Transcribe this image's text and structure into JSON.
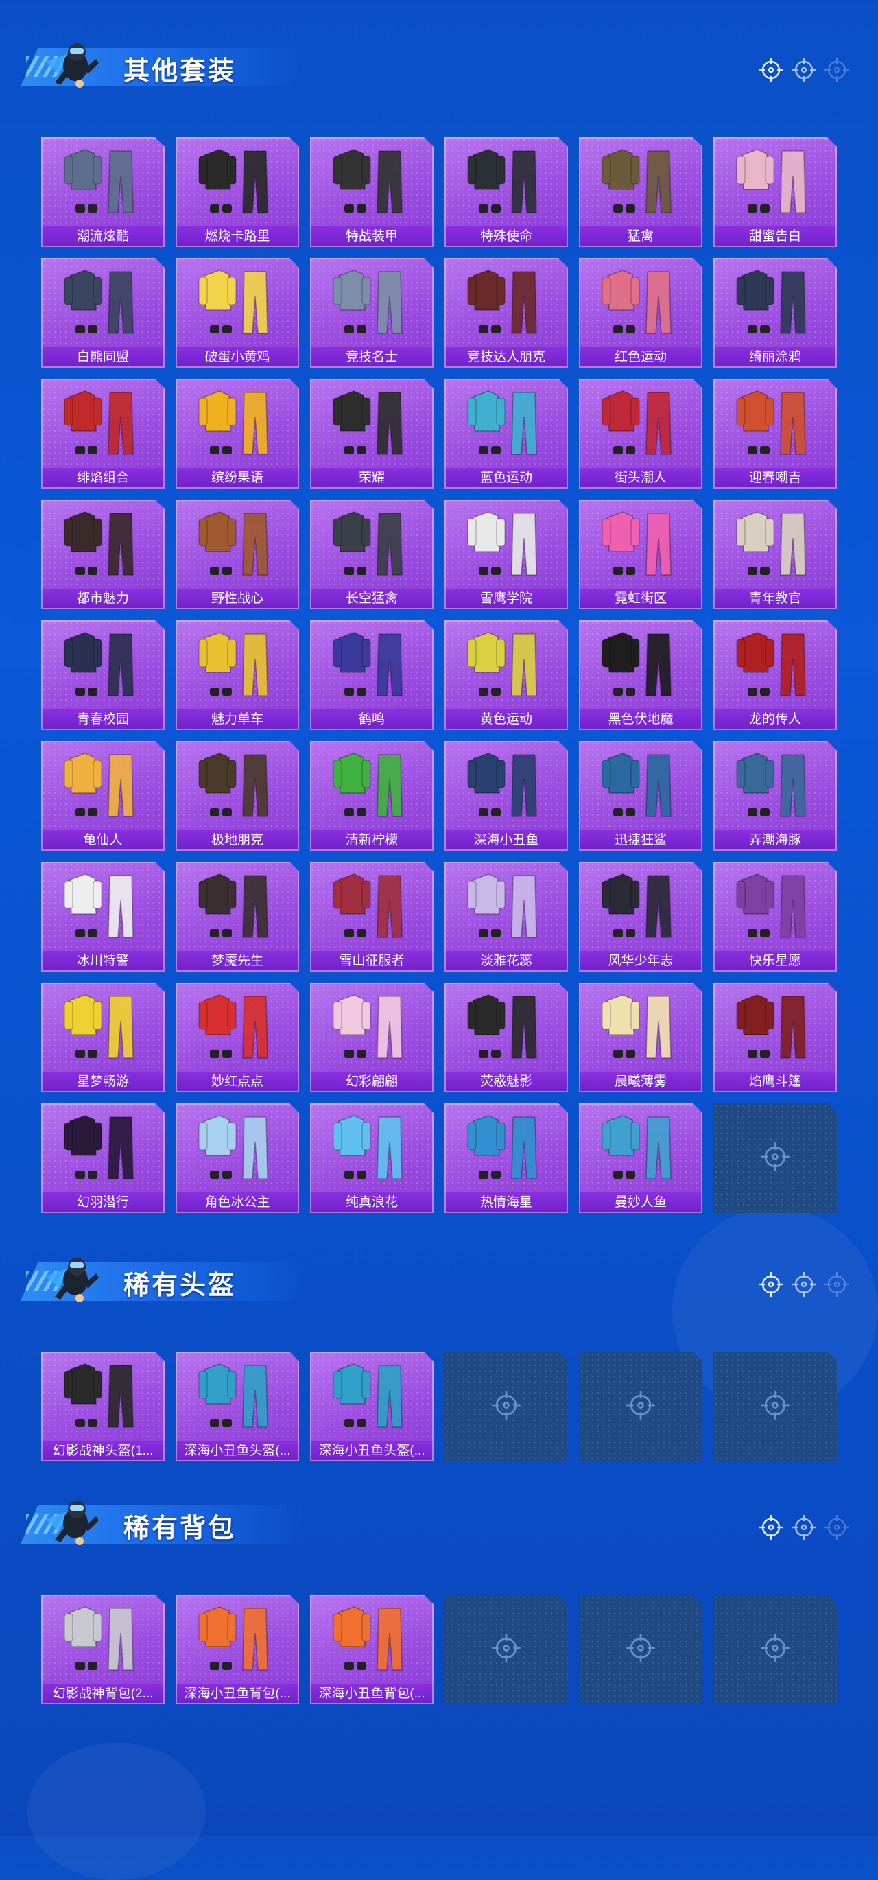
{
  "sections": [
    {
      "title": "其他套装",
      "items": [
        {
          "label": "潮流炫酷",
          "color": "#5d6f8c"
        },
        {
          "label": "燃烧卡路里",
          "color": "#2a2a2a"
        },
        {
          "label": "特战装甲",
          "color": "#333333"
        },
        {
          "label": "特殊使命",
          "color": "#2b2f36"
        },
        {
          "label": "猛禽",
          "color": "#6b5b3a"
        },
        {
          "label": "甜蜜告白",
          "color": "#e8b6c8"
        },
        {
          "label": "白熊同盟",
          "color": "#3a4560"
        },
        {
          "label": "破蛋小黄鸡",
          "color": "#f2d34a"
        },
        {
          "label": "竞技名士",
          "color": "#7d8fa8"
        },
        {
          "label": "竞技达人朋克",
          "color": "#6a2a2a"
        },
        {
          "label": "红色运动",
          "color": "#e0708a"
        },
        {
          "label": "绮丽涂鸦",
          "color": "#2e3a55"
        },
        {
          "label": "绯焰组合",
          "color": "#c02a2a"
        },
        {
          "label": "缤纷果语",
          "color": "#f0b020"
        },
        {
          "label": "荣耀",
          "color": "#2e2e2e"
        },
        {
          "label": "蓝色运动",
          "color": "#3fb0d0"
        },
        {
          "label": "街头潮人",
          "color": "#c02838"
        },
        {
          "label": "迎春嘲吉",
          "color": "#d05030"
        },
        {
          "label": "都市魅力",
          "color": "#3a2a2a"
        },
        {
          "label": "野性战心",
          "color": "#a05a30"
        },
        {
          "label": "长空猛禽",
          "color": "#3a4048"
        },
        {
          "label": "雪鹰学院",
          "color": "#e8e8e8"
        },
        {
          "label": "霓虹街区",
          "color": "#f060b0"
        },
        {
          "label": "青年教官",
          "color": "#d8d0c0"
        },
        {
          "label": "青春校园",
          "color": "#2a3050"
        },
        {
          "label": "魅力单车",
          "color": "#e8c030"
        },
        {
          "label": "鹤鸣",
          "color": "#3a3a9a"
        },
        {
          "label": "黄色运动",
          "color": "#d8d040"
        },
        {
          "label": "黑色伏地魔",
          "color": "#1e1e1e"
        },
        {
          "label": "龙的传人",
          "color": "#b02020"
        },
        {
          "label": "龟仙人",
          "color": "#f0b040"
        },
        {
          "label": "极地朋克",
          "color": "#4a3a2a"
        },
        {
          "label": "清新柠檬",
          "color": "#40b040"
        },
        {
          "label": "深海小丑鱼",
          "color": "#2a4070"
        },
        {
          "label": "迅捷狂鲨",
          "color": "#2a6aa0"
        },
        {
          "label": "弄潮海豚",
          "color": "#3a6a9a"
        },
        {
          "label": "冰川特警",
          "color": "#eeeeee"
        },
        {
          "label": "梦魇先生",
          "color": "#3a3030"
        },
        {
          "label": "雪山征服者",
          "color": "#a03040"
        },
        {
          "label": "淡雅花蕊",
          "color": "#c8b8e8"
        },
        {
          "label": "风华少年志",
          "color": "#2a2a38"
        },
        {
          "label": "快乐星愿",
          "color": "#8040a0"
        },
        {
          "label": "星梦畅游",
          "color": "#f0d030"
        },
        {
          "label": "妙红点点",
          "color": "#d83030"
        },
        {
          "label": "幻彩翩翩",
          "color": "#f0c8e0"
        },
        {
          "label": "荧惑魅影",
          "color": "#2a2a2a"
        },
        {
          "label": "晨曦薄雾",
          "color": "#f0e0b0"
        },
        {
          "label": "焰鹰斗篷",
          "color": "#802020"
        },
        {
          "label": "幻羽潜行",
          "color": "#2a1a3a"
        },
        {
          "label": "角色冰公主",
          "color": "#a8d0f0"
        },
        {
          "label": "纯真浪花",
          "color": "#60c0f0"
        },
        {
          "label": "热情海星",
          "color": "#3090d0"
        },
        {
          "label": "曼妙人鱼",
          "color": "#40a0d0"
        },
        {
          "label": "",
          "color": ""
        }
      ]
    },
    {
      "title": "稀有头盔",
      "items": [
        {
          "label": "幻影战神头盔(1...",
          "color": "#2a2a2a"
        },
        {
          "label": "深海小丑鱼头盔(...",
          "color": "#30a0c8"
        },
        {
          "label": "深海小丑鱼头盔(...",
          "color": "#30a0c8"
        },
        {
          "label": "",
          "color": ""
        },
        {
          "label": "",
          "color": ""
        },
        {
          "label": "",
          "color": ""
        }
      ]
    },
    {
      "title": "稀有背包",
      "items": [
        {
          "label": "幻影战神背包(2...",
          "color": "#c8c8d0"
        },
        {
          "label": "深海小丑鱼背包(...",
          "color": "#f07030"
        },
        {
          "label": "深海小丑鱼背包(...",
          "color": "#f07030"
        },
        {
          "label": "",
          "color": ""
        },
        {
          "label": "",
          "color": ""
        },
        {
          "label": "",
          "color": ""
        }
      ]
    }
  ]
}
